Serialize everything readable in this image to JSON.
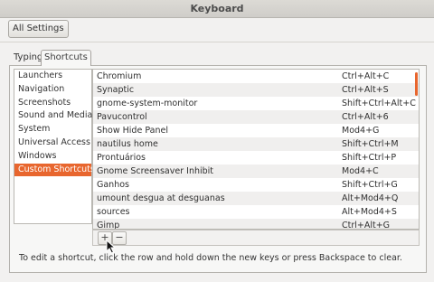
{
  "window": {
    "title": "Keyboard"
  },
  "toolbar": {
    "all_settings_label": "All Settings"
  },
  "tabs": [
    {
      "label": "Typing"
    },
    {
      "label": "Shortcuts"
    }
  ],
  "categories": [
    {
      "label": "Launchers"
    },
    {
      "label": "Navigation"
    },
    {
      "label": "Screenshots"
    },
    {
      "label": "Sound and Media"
    },
    {
      "label": "System"
    },
    {
      "label": "Universal Access"
    },
    {
      "label": "Windows"
    },
    {
      "label": "Custom Shortcuts"
    }
  ],
  "shortcuts": [
    {
      "name": "Chromium",
      "accel": "Ctrl+Alt+C"
    },
    {
      "name": "Synaptic",
      "accel": "Ctrl+Alt+S"
    },
    {
      "name": "gnome-system-monitor",
      "accel": "Shift+Ctrl+Alt+C"
    },
    {
      "name": "Pavucontrol",
      "accel": "Ctrl+Alt+6"
    },
    {
      "name": "Show Hide Panel",
      "accel": "Mod4+G"
    },
    {
      "name": "nautilus home",
      "accel": "Shift+Ctrl+M"
    },
    {
      "name": "Prontuários",
      "accel": "Shift+Ctrl+P"
    },
    {
      "name": "Gnome Screensaver Inhibit",
      "accel": "Mod4+C"
    },
    {
      "name": "Ganhos",
      "accel": "Shift+Ctrl+G"
    },
    {
      "name": "umount desgua at desguanas",
      "accel": "Alt+Mod4+Q"
    },
    {
      "name": "sources",
      "accel": "Alt+Mod4+S"
    },
    {
      "name": "Gimp",
      "accel": "Ctrl+Alt+G"
    }
  ],
  "list_toolbar": {
    "add_label": "+",
    "remove_label": "−"
  },
  "hint": "To edit a shortcut, click the row and hold down the new keys or press Backspace to clear.",
  "colors": {
    "selection": "#e8662e"
  }
}
